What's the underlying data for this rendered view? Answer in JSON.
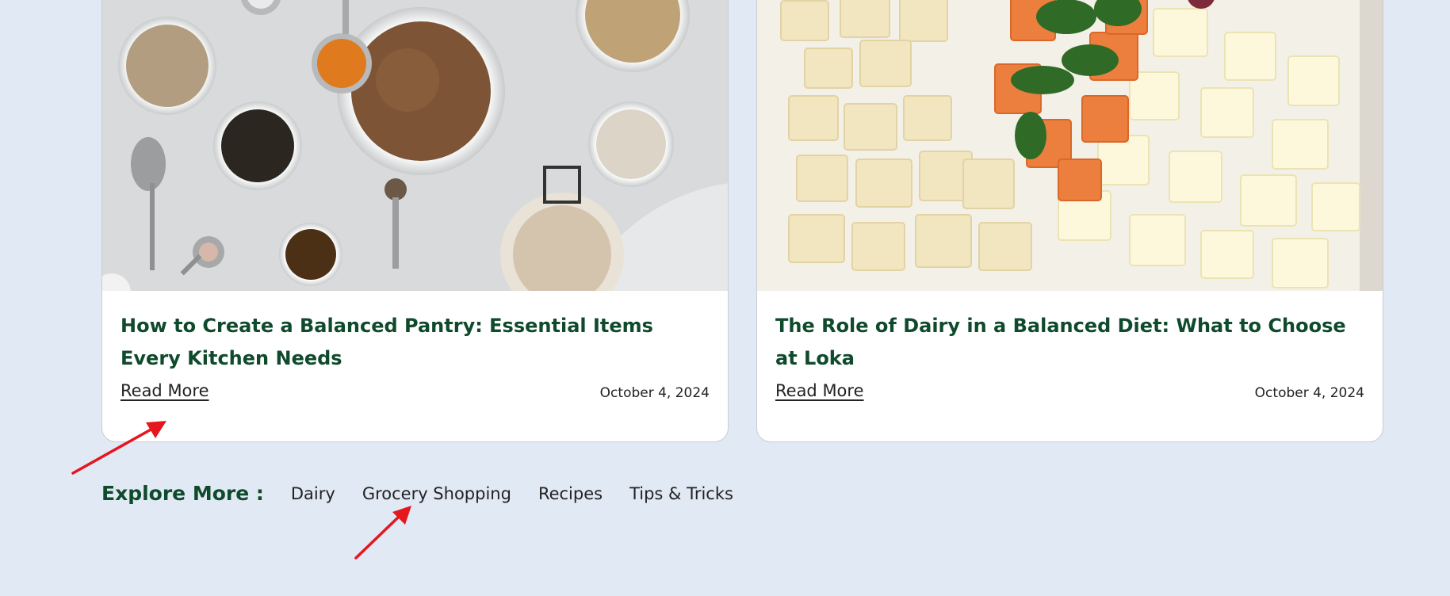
{
  "cards": [
    {
      "title": "How to Create a Balanced Pantry: Essential Items Every Kitchen Needs",
      "read_more": "Read More",
      "date": "October 4, 2024"
    },
    {
      "title": "The Role of Dairy in a Balanced Diet: What to Choose at Loka",
      "read_more": "Read More",
      "date": "October 4, 2024"
    }
  ],
  "explore": {
    "label": "Explore More :",
    "links": [
      "Dairy",
      "Grocery Shopping",
      "Recipes",
      "Tips & Tricks"
    ]
  },
  "colors": {
    "page_background": "#e1e9f4",
    "title_green": "#0f4a2c",
    "annotation_arrow": "#e5161e"
  }
}
